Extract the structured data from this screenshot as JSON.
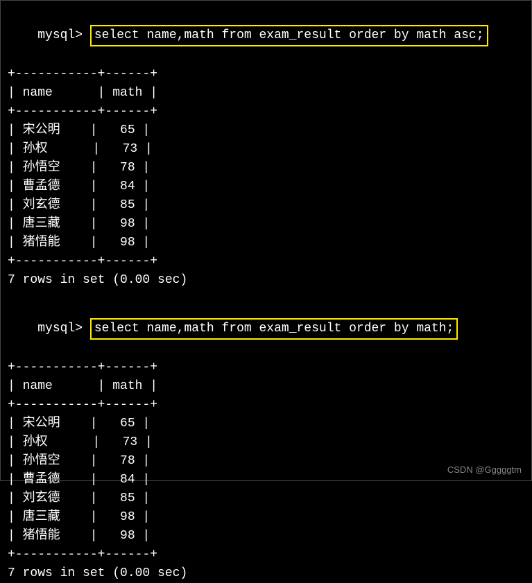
{
  "query1": {
    "prompt": "mysql> ",
    "sql": "select name,math from exam_result order by math asc;",
    "border_top": "+-----------+------+",
    "header": "| name      | math |",
    "border_mid": "+-----------+------+",
    "rows": [
      "| 宋公明    |   65 |",
      "| 孙权      |   73 |",
      "| 孙悟空    |   78 |",
      "| 曹孟德    |   84 |",
      "| 刘玄德    |   85 |",
      "| 唐三藏    |   98 |",
      "| 猪悟能    |   98 |"
    ],
    "border_bot": "+-----------+------+",
    "status": "7 rows in set (0.00 sec)"
  },
  "query2": {
    "prompt": "mysql> ",
    "sql": "select name,math from exam_result order by math;",
    "border_top": "+-----------+------+",
    "header": "| name      | math |",
    "border_mid": "+-----------+------+",
    "rows": [
      "| 宋公明    |   65 |",
      "| 孙权      |   73 |",
      "| 孙悟空    |   78 |",
      "| 曹孟德    |   84 |",
      "| 刘玄德    |   85 |",
      "| 唐三藏    |   98 |",
      "| 猪悟能    |   98 |"
    ],
    "border_bot": "+-----------+------+",
    "status": "7 rows in set (0.00 sec)"
  },
  "watermark": "CSDN @Gggggtm"
}
